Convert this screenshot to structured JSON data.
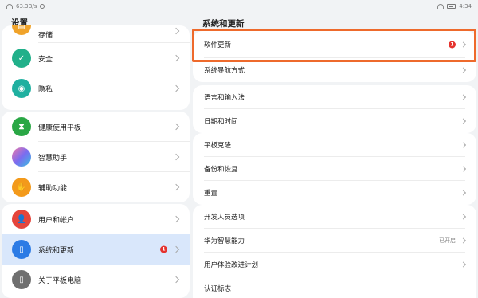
{
  "status": {
    "net_speed": "63.3B/s",
    "time": "4:34"
  },
  "left": {
    "title": "设置",
    "items": [
      {
        "label": "存储",
        "icon": "storage-icon",
        "color": "#f0a32a"
      },
      {
        "label": "安全",
        "icon": "shield-icon",
        "color": "#21b08a"
      },
      {
        "label": "隐私",
        "icon": "privacy-icon",
        "color": "#1fb0a0"
      },
      {
        "label": "健康使用平板",
        "icon": "hourglass-icon",
        "color": "#2aa745"
      },
      {
        "label": "智慧助手",
        "icon": "assistant-icon",
        "color": "#b56cf0"
      },
      {
        "label": "辅助功能",
        "icon": "hand-icon",
        "color": "#f39a1b"
      },
      {
        "label": "用户和帐户",
        "icon": "user-icon",
        "color": "#e5453b"
      },
      {
        "label": "系统和更新",
        "icon": "phone-update-icon",
        "color": "#2c7be5",
        "badge": "1"
      },
      {
        "label": "关于平板电脑",
        "icon": "tablet-icon",
        "color": "#6f6f6f"
      }
    ]
  },
  "right": {
    "title": "系统和更新",
    "items": [
      {
        "label": "软件更新",
        "badge": "1"
      },
      {
        "label": "系统导航方式"
      },
      {
        "label": "语言和输入法"
      },
      {
        "label": "日期和时间"
      },
      {
        "label": "平板克隆"
      },
      {
        "label": "备份和恢复"
      },
      {
        "label": "重置"
      },
      {
        "label": "开发人员选项"
      },
      {
        "label": "华为智慧能力",
        "value": "已开启"
      },
      {
        "label": "用户体验改进计划"
      },
      {
        "label": "认证标志"
      }
    ]
  },
  "accent": {
    "highlight": "#ee6a2c",
    "badge": "#e5322d",
    "selected": "#d9e7fb"
  }
}
